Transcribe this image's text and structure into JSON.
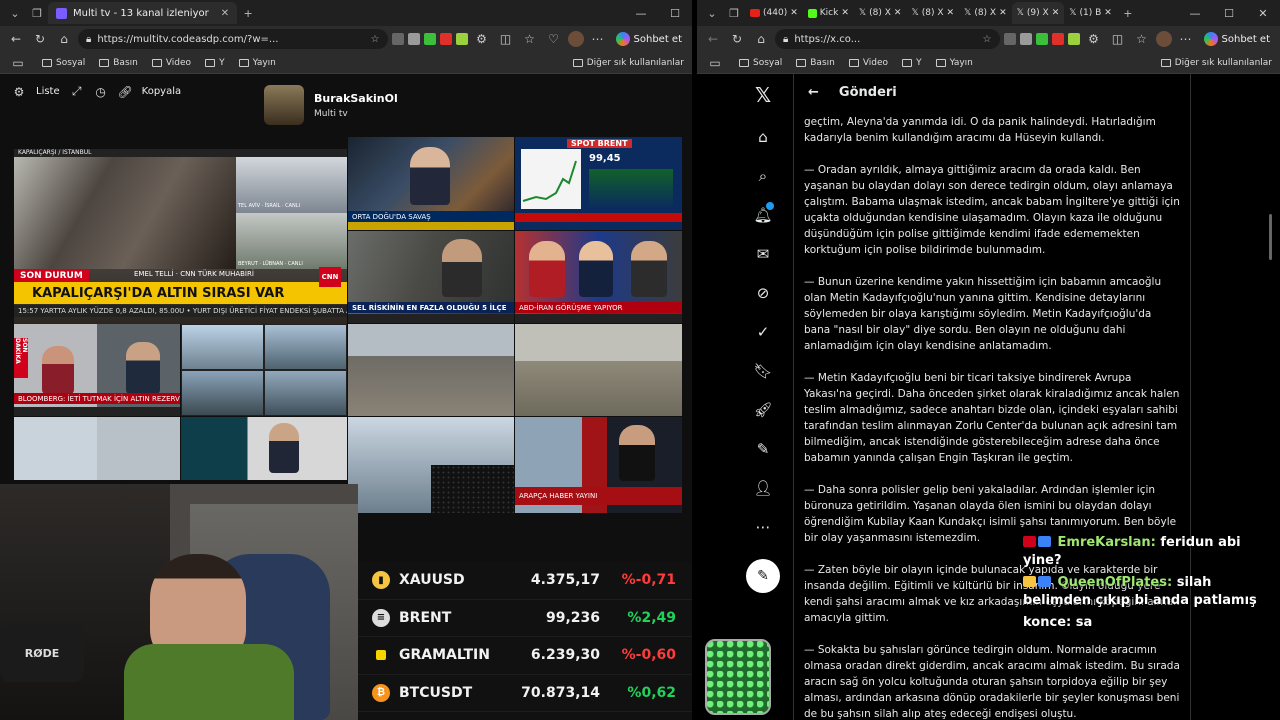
{
  "left_browser": {
    "tab_title": "Multi tv - 13 kanal izleniyor",
    "url": "https://multitv.codeasdp.com/?w=...",
    "copilot_label": "Sohbet et",
    "bookmarks": [
      "Sosyal",
      "Basın",
      "Video",
      "Y",
      "Yayın"
    ],
    "bookmarks_other": "Diğer sık kullanılanlar"
  },
  "multitv": {
    "toolbar": {
      "list_label": "Liste",
      "copy_label": "Kopyala"
    },
    "channel": {
      "name": "BurakSakinOl",
      "subtitle": "Multi tv"
    },
    "cells": {
      "c1_location": "KAPALIÇARŞI / İSTANBUL",
      "c1_tag": "SON DURUM",
      "c1_reporter": "EMEL TELLİ · CNN TÜRK MUHABİRİ",
      "c1_headline": "KAPALIÇARŞI'DA ALTIN SIRASI VAR",
      "c1_ticker": "15:57  YARTTA AYLIK YÜZDE 0,8 AZALDI, 85.00U  •  YURT DIŞI ÜRETİCİ FİYAT ENDEKSİ ŞUBATTA AYI  12.944",
      "c2_caption": "TEL AVİV · İSRAİL · CANLI",
      "c3_caption": "BEYRUT · LÜBNAN · CANLI",
      "c4_caption": "ORTA DOĞU'DA SAVAŞ",
      "c5_title": "SPOT BRENT",
      "c5_value": "99,45",
      "c6_caption": "SEL RİSKİNİN EN FAZLA OLDUĞU 5 İLÇE",
      "c7_caption": "ABD-İRAN GÖRÜŞME YAPIYOR",
      "c8_tag": "SON DAKİKA",
      "c8_caption": "BLOOMBERG: İETİ TUTMAK İÇİN ALTIN REZERVİ KULLANILACAK",
      "c13_caption": "ARAPÇA HABER YAYINI"
    },
    "prices": [
      {
        "symbol": "XAUUSD",
        "value": "4.375,17",
        "change": "%-0,71",
        "color": "#ff3b3b",
        "coin": "#f5c542"
      },
      {
        "symbol": "BRENT",
        "value": "99,236",
        "change": "%2,49",
        "color": "#22d15b",
        "coin": "#dddddd"
      },
      {
        "symbol": "GRAMALTIN",
        "value": "6.239,30",
        "change": "%-0,60",
        "color": "#ff3b3b",
        "coin": "#f5d400"
      },
      {
        "symbol": "BTCUSDT",
        "value": "70.873,14",
        "change": "%0,62",
        "color": "#22d15b",
        "coin": "#f7931a"
      }
    ]
  },
  "right_browser": {
    "tabs": [
      "(440)",
      "Kick",
      "(8) X",
      "(8) X",
      "(8) X",
      "(9) X",
      "(1) B"
    ],
    "url": "https://x.co...",
    "copilot_label": "Sohbet et",
    "bookmarks": [
      "Sosyal",
      "Basın",
      "Video",
      "Y",
      "Yayın"
    ],
    "bookmarks_other": "Diğer sık kullanılanlar"
  },
  "x_post": {
    "header": "Gönderi",
    "paragraphs": [
      "geçtim, Aleyna'da yanımda idi. O da panik halindeydi. Hatırladığım kadarıyla benim kullandığım aracımı da Hüseyin kullandı.",
      "— Oradan ayrıldık, almaya gittiğimiz aracım da orada kaldı. Ben yaşanan bu olaydan dolayı son derece tedirgin oldum, olayı anlamaya çalıştım. Babama ulaşmak istedim, ancak babam İngiltere'ye gittiği için uçakta olduğundan kendisine ulaşamadım. Olayın kaza ile olduğunu düşündüğüm için polise gittiğimde kendimi ifade edememekten korktuğum için polise bildirimde bulunmadım.",
      "— Bunun üzerine kendime yakın hissettiğim için babamın amcaoğlu olan Metin Kadayıfçıoğlu'nun yanına gittim. Kendisine detaylarını söylemeden bir olaya karıştığımı söyledim. Metin Kadayıfçıoğlu'da bana \"nasıl bir olay\" diye sordu. Ben olayın ne olduğunu dahi anlamadığım için olayı kendisine anlatamadım.",
      "— Metin Kadayıfçıoğlu beni bir ticari taksiye bindirerek Avrupa Yakası'na geçirdi. Daha önceden şirket olarak kiraladığımız ancak halen teslim almadığımız, sadece anahtarı bizde olan, içindeki eşyaları sahibi tarafından teslim alınmayan Zorlu Center'da bulunan açık adresini tam bilmediğim, ancak istendiğinde gösterebileceğim adrese daha önce babamın yanında çalışan Engin Taşkıran ile geçtim.",
      "— Daha sonra polisler gelip beni yakaladılar. Ardından işlemler için büronuza getirildim. Yaşanan olayda ölen ismini bu olaydan dolayı öğrendiğim Kubilay Kaan Kundakçı isimli şahsı tanımıyorum. Ben böyle bir olay yaşanmasını istemezdim.",
      "— Zaten böyle bir olayın içinde bulunacak yapıda ve karakterde bir insanda değilim. Eğitimli ve kültürlü bir insanım. Olayın olduğu yere kendi şahsi aracımı almak ve kız arkadaşımın eşyalarını köpeğini almak amacıyla gittim.",
      "— Sokakta bu şahısları görünce tedirgin oldum. Normalde aracımın olmasa oradan direkt giderdim, ancak aracımı almak istedim. Bu sırada aracın sağ ön yolcu koltuğunda oturan şahsın torpidoya eğilip bir şey alması, ardından arkasına dönüp oradakilerle bir şeyler konuşması beni de bu şahsın silah alıp ateş edeceği endişesi oluştu."
    ]
  },
  "stream_chat": [
    {
      "user": "EmreKarslan:",
      "message": "feridun abi yine?",
      "user_color": "#9fe870"
    },
    {
      "user": "QueenOfPlates:",
      "message": "silah belimden çıkıp bi anda patlamış",
      "user_color": "#9fe870"
    },
    {
      "user": "konce:",
      "message": "sa",
      "user_color": "#ffffff"
    }
  ]
}
